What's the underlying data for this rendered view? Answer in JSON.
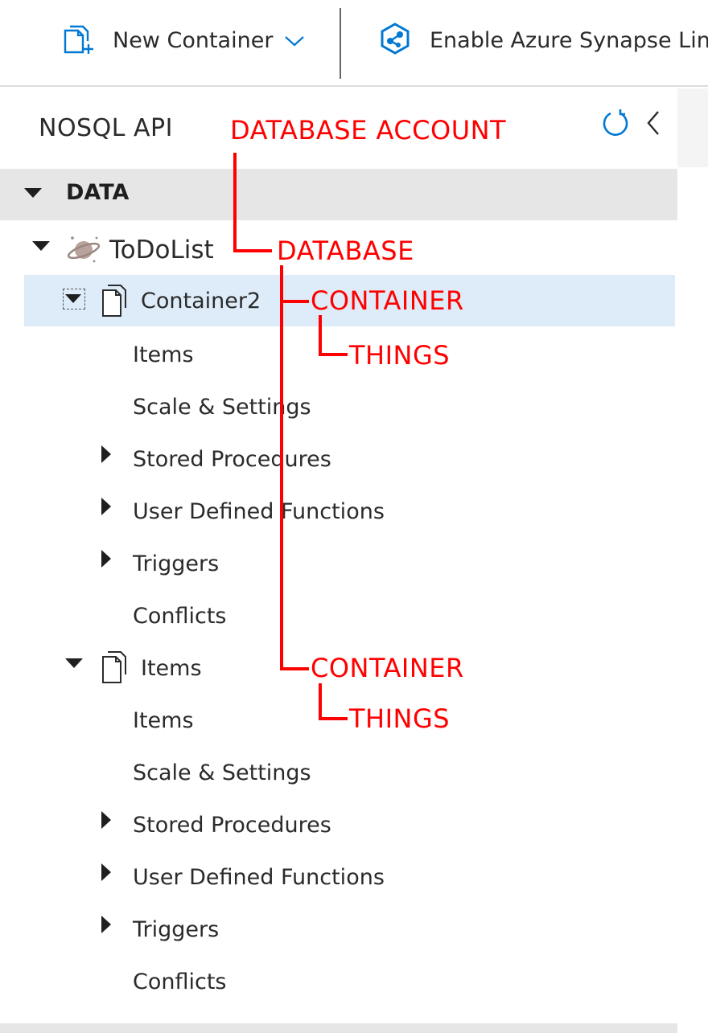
{
  "toolbar": {
    "new_container_label": "New Container",
    "synapse_label": "Enable Azure Synapse Link"
  },
  "panel": {
    "title": "NOSQL API"
  },
  "section": {
    "label": "DATA"
  },
  "tree": {
    "database": {
      "label": "ToDoList"
    },
    "containers": [
      {
        "label": "Container2",
        "selected": true,
        "children": [
          "Items",
          "Scale & Settings",
          "Stored Procedures",
          "User Defined Functions",
          "Triggers",
          "Conflicts"
        ]
      },
      {
        "label": "Items",
        "selected": false,
        "children": [
          "Items",
          "Scale & Settings",
          "Stored Procedures",
          "User Defined Functions",
          "Triggers",
          "Conflicts"
        ]
      }
    ]
  },
  "annotations": {
    "database_account": "DATABASE ACCOUNT",
    "database": "DATABASE",
    "container_1": "CONTAINER",
    "things_1": "THINGS",
    "container_2": "CONTAINER",
    "things_2": "THINGS"
  },
  "colors": {
    "accent_blue": "#0078d4",
    "selection": "#deecf9",
    "section_bar": "#e6e6e6",
    "annotation_red": "#ff0000"
  },
  "icons": {
    "new_container": "new-container-icon",
    "synapse": "synapse-link-icon",
    "dropdown": "chevron-down-icon",
    "refresh": "refresh-icon",
    "collapse": "chevron-left-icon",
    "database": "cosmos-database-icon",
    "container": "document-container-icon"
  }
}
